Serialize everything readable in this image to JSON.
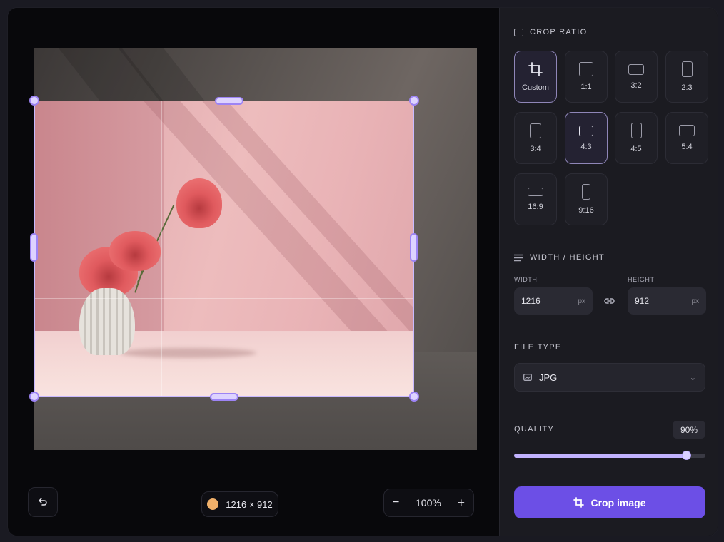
{
  "editor": {
    "dimensions_label": "1216 × 912",
    "zoom_level": "100%",
    "zoom_out_label": "−",
    "zoom_in_label": "+",
    "undo_icon": "undo-icon"
  },
  "panel": {
    "crop_ratio": {
      "title": "CROP RATIO",
      "options": [
        {
          "label": "Custom",
          "selected": false
        },
        {
          "label": "1:1",
          "selected": false
        },
        {
          "label": "3:2",
          "selected": false
        },
        {
          "label": "2:3",
          "selected": false
        },
        {
          "label": "3:4",
          "selected": false
        },
        {
          "label": "4:3",
          "selected": true
        },
        {
          "label": "4:5",
          "selected": false
        },
        {
          "label": "5:4",
          "selected": false
        },
        {
          "label": "16:9",
          "selected": false
        },
        {
          "label": "9:16",
          "selected": false
        }
      ]
    },
    "size": {
      "title": "WIDTH / HEIGHT",
      "width_label": "WIDTH",
      "width_value": "1216",
      "height_label": "HEIGHT",
      "height_value": "912",
      "unit": "px"
    },
    "file_type": {
      "title": "FILE TYPE",
      "selected": "JPG"
    },
    "quality": {
      "title": "QUALITY",
      "value_label": "90%",
      "value": 0.9
    },
    "crop_button_label": "Crop image"
  },
  "colors": {
    "accent": "#6c4fe6",
    "handle": "#ddd3ff",
    "dimension_dot": "#f0b06a"
  }
}
